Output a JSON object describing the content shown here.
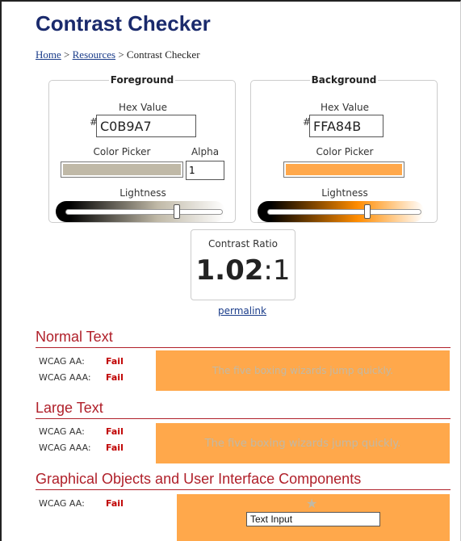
{
  "title": "Contrast Checker",
  "breadcrumb": {
    "home": "Home",
    "sep1": " > ",
    "resources": "Resources",
    "sep2": " > ",
    "current": "Contrast Checker"
  },
  "foreground": {
    "legend": "Foreground",
    "hex_label": "Hex Value",
    "hash": "#",
    "hex_value": "C0B9A7",
    "picker_label": "Color Picker",
    "alpha_label": "Alpha",
    "alpha_value": "1",
    "lightness_label": "Lightness",
    "lightness_percent": 71
  },
  "background": {
    "legend": "Background",
    "hex_label": "Hex Value",
    "hash": "#",
    "hex_value": "FFA84B",
    "picker_label": "Color Picker",
    "lightness_label": "Lightness",
    "lightness_percent": 65
  },
  "ratio": {
    "label": "Contrast Ratio",
    "value": "1.02",
    "suffix": ":1"
  },
  "permalink": "permalink",
  "sections": {
    "normal": {
      "title": "Normal Text",
      "aa_label": "WCAG AA:",
      "aa_result": "Fail",
      "aaa_label": "WCAG AAA:",
      "aaa_result": "Fail",
      "sample": "The five boxing wizards jump quickly."
    },
    "large": {
      "title": "Large Text",
      "aa_label": "WCAG AA:",
      "aa_result": "Fail",
      "aaa_label": "WCAG AAA:",
      "aaa_result": "Fail",
      "sample": "The five boxing wizards jump quickly."
    },
    "graphical": {
      "title": "Graphical Objects and User Interface Components",
      "aa_label": "WCAG AA:",
      "aa_result": "Fail",
      "star": "★",
      "input_value": "Text Input"
    }
  },
  "colors": {
    "fg": "#C0B9A7",
    "bg": "#FFA84B",
    "heading": "#1a2a6c",
    "section": "#b0202a",
    "fail": "#c00000"
  }
}
